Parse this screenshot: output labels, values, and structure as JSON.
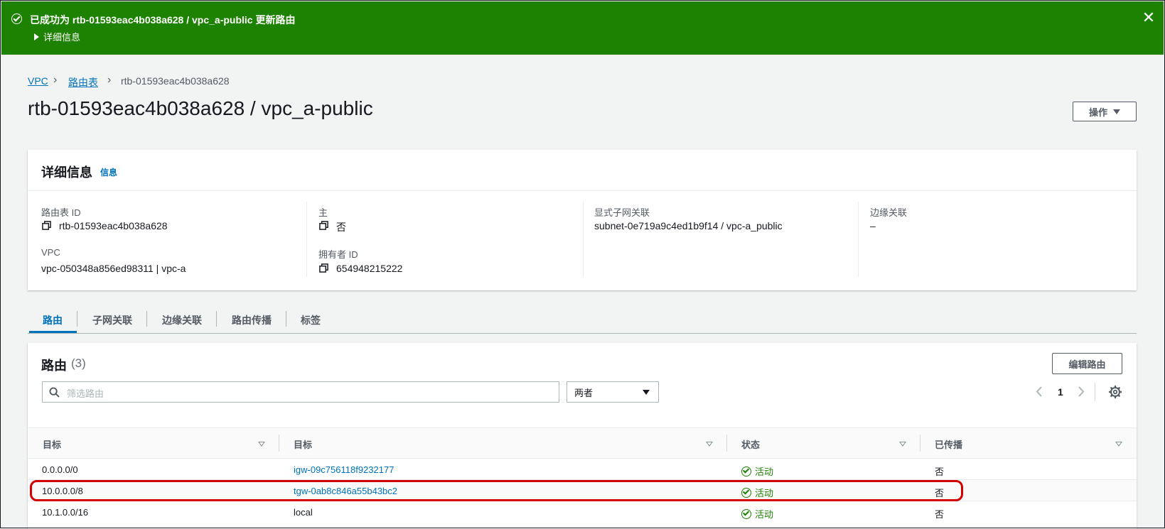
{
  "flash": {
    "message": "已成功为 rtb-01593eac4b038a628 / vpc_a-public 更新路由",
    "details_label": "详细信息",
    "close_symbol": "✕"
  },
  "breadcrumb": {
    "items": [
      "VPC",
      "路由表",
      "rtb-01593eac4b038a628"
    ],
    "separator": "›"
  },
  "page": {
    "title": "rtb-01593eac4b038a628 / vpc_a-public",
    "actions_label": "操作"
  },
  "details": {
    "heading": "详细信息",
    "info_link": "信息",
    "fields": {
      "route_table_id_label": "路由表 ID",
      "route_table_id": "rtb-01593eac4b038a628",
      "main_label": "主",
      "main_value": "否",
      "explicit_subnet_label": "显式子网关联",
      "explicit_subnet_value": "subnet-0e719a9c4ed1b9f14 / vpc-a_public",
      "edge_assoc_label": "边缘关联",
      "edge_assoc_value": "–",
      "vpc_label": "VPC",
      "vpc_value": "vpc-050348a856ed98311 | vpc-a",
      "owner_label": "拥有者 ID",
      "owner_value": "654948215222"
    }
  },
  "tabs": [
    {
      "label": "路由",
      "active": true
    },
    {
      "label": "子网关联",
      "active": false
    },
    {
      "label": "边缘关联",
      "active": false
    },
    {
      "label": "路由传播",
      "active": false
    },
    {
      "label": "标签",
      "active": false
    }
  ],
  "routes": {
    "title": "路由",
    "count": "(3)",
    "edit_label": "编辑路由",
    "search_placeholder": "筛选路由",
    "filter_value": "两者",
    "page_number": "1",
    "columns": [
      "目标",
      "目标",
      "状态",
      "已传播"
    ],
    "rows": [
      {
        "destination": "0.0.0.0/0",
        "target": "igw-09c756118f9232177",
        "target_link": true,
        "status": "活动",
        "propagated": "否"
      },
      {
        "destination": "10.0.0.0/8",
        "target": "tgw-0ab8c846a55b43bc2",
        "target_link": true,
        "status": "活动",
        "propagated": "否"
      },
      {
        "destination": "10.1.0.0/16",
        "target": "local",
        "target_link": false,
        "status": "活动",
        "propagated": "否"
      }
    ]
  },
  "colors": {
    "success": "#1d8102",
    "link": "#0073bb",
    "highlight": "#d40000"
  }
}
